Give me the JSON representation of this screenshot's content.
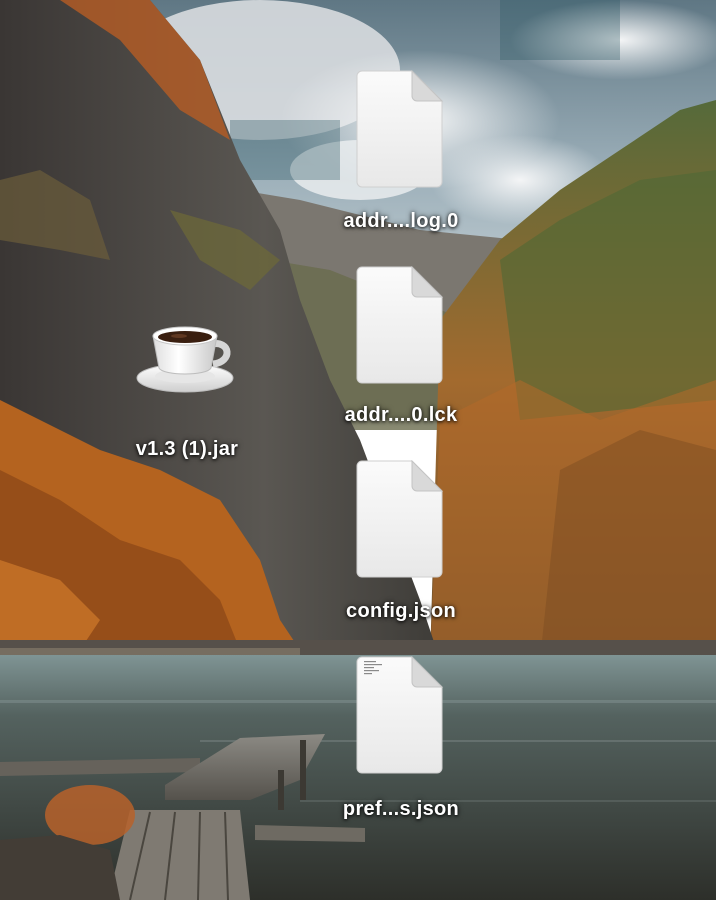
{
  "desktop": {
    "wallpaper": "mountain-fjord-autumn-with-wooden-pier",
    "colors": {
      "sky": "#8fa7b3",
      "cloud": "#e9ecee",
      "rock": "#4b4a47",
      "foliage_orange": "#c3672a",
      "foliage_green": "#6e6a2c",
      "water": "#4e5a58",
      "label_text": "#ffffff"
    },
    "icons": [
      {
        "id": "addr-log",
        "label": "addr....log.0",
        "icon": "generic-document-icon"
      },
      {
        "id": "addr-lck",
        "label": "addr....0.lck",
        "icon": "generic-document-icon"
      },
      {
        "id": "jar",
        "label": "v1.3 (1).jar",
        "icon": "java-coffee-cup-icon"
      },
      {
        "id": "config",
        "label": "config.json",
        "icon": "generic-document-icon"
      },
      {
        "id": "prefs",
        "label": "pref...s.json",
        "icon": "text-document-icon"
      }
    ]
  }
}
